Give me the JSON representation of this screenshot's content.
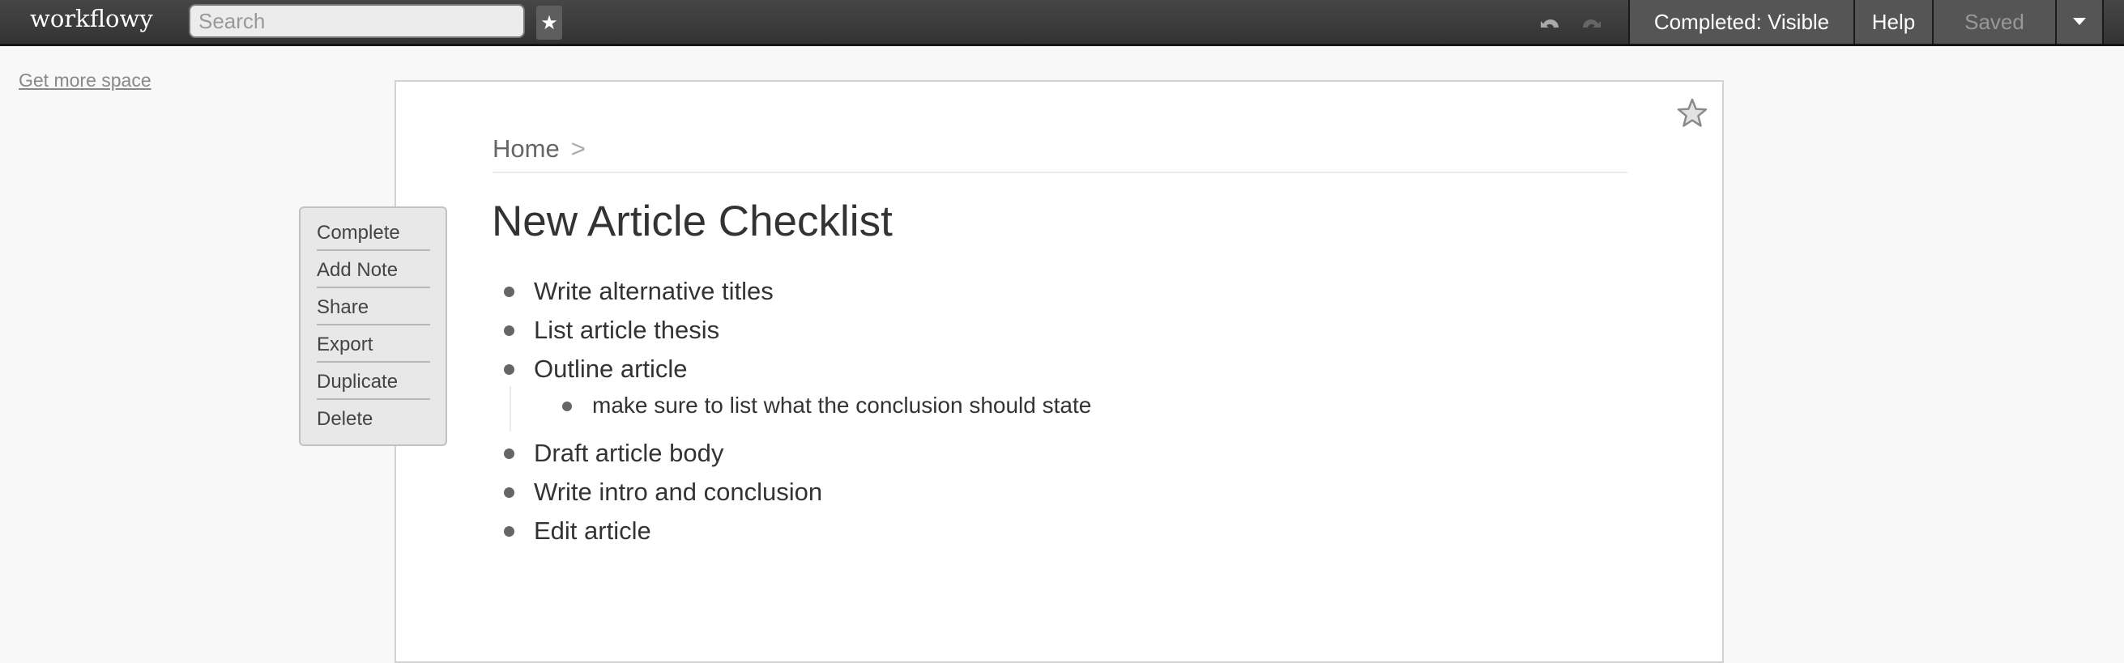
{
  "topbar": {
    "logo": "workflowy",
    "search_placeholder": "Search",
    "star_button_icon": "star-icon",
    "undo_icon": "undo-icon",
    "redo_icon": "redo-icon",
    "completed_label": "Completed: Visible",
    "help_label": "Help",
    "saved_label": "Saved",
    "dropdown_icon": "caret-down-icon"
  },
  "sidebar": {
    "get_more_space": "Get more space"
  },
  "page": {
    "breadcrumb": {
      "home": "Home",
      "separator": ">"
    },
    "title": "New Article Checklist",
    "star_icon": "star-outline-icon",
    "items": [
      {
        "text": "Write alternative titles",
        "level": 0
      },
      {
        "text": "List article thesis",
        "level": 0
      },
      {
        "text": "Outline article",
        "level": 0
      },
      {
        "text": "make sure to list what the conclusion should state",
        "level": 1
      },
      {
        "text": "Draft article body",
        "level": 0
      },
      {
        "text": "Write intro and conclusion",
        "level": 0
      },
      {
        "text": "Edit article",
        "level": 0
      }
    ]
  },
  "context_menu": {
    "items": [
      "Complete",
      "Add Note",
      "Share",
      "Export",
      "Duplicate",
      "Delete"
    ]
  },
  "colors": {
    "topbar_bg": "#3a3a3a",
    "button_bg": "#555555",
    "page_bg": "#f8f8f8",
    "panel_bg": "#ffffff",
    "text": "#333333",
    "muted": "#999999"
  }
}
